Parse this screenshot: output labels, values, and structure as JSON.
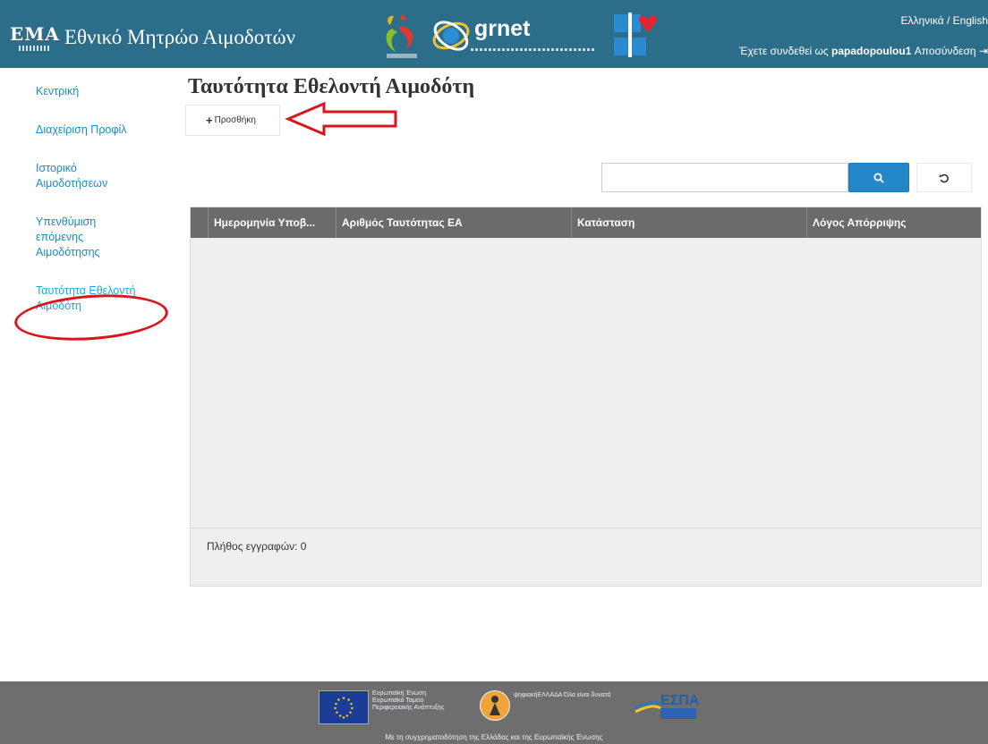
{
  "header": {
    "logo_text": "ΕΜΑ",
    "title": "Εθνικό Μητρώο Αιμοδοτών",
    "partner_logo_text": "grnet",
    "language": "Ελληνικά / English",
    "login_prefix": "Έχετε συνδεθεί ως",
    "username": "papadopoulou1",
    "logout_label": "Αποσύνδεση"
  },
  "sidebar": {
    "items": [
      {
        "label": "Κεντρική"
      },
      {
        "label": "Διαχείριση Προφίλ"
      },
      {
        "label": "Ιστορικό Αιμοδοτήσεων"
      },
      {
        "label": "Υπενθύμιση επόμενης Αιμοδότησης"
      },
      {
        "label": "Ταυτότητα Εθελοντή Αιμοδότη"
      }
    ]
  },
  "main": {
    "title": "Ταυτότητα Εθελοντή Αιμοδότη",
    "add_label": "Προσθήκη",
    "search": {
      "value": "",
      "placeholder": ""
    },
    "grid": {
      "columns": [
        "",
        "Ημερομηνία Υποβ...",
        "Αριθμός Ταυτότητας ΕΑ",
        "Κατάσταση",
        "Λόγος Απόρριψης"
      ],
      "count_label": "Πλήθος εγγραφών: 0"
    }
  },
  "footer": {
    "eu_text": "Ευρωπαϊκή Ένωση Ευρωπαϊκό Ταμείο Περιφερειακής Ανάπτυξης",
    "digital_text": "ψηφιακήΕΛΛΑΔΑ Όλα είναι δυνατά",
    "espa_text": "ΕΣΠΑ",
    "note": "Με τη συγχρηματοδότηση της Ελλάδας και της Ευρωπαϊκής Ένωσης"
  },
  "colors": {
    "header_bg": "#2c6d8a",
    "link": "#1c8bc2",
    "active_link": "#1fa7d8",
    "grid_header": "#6b6b6b",
    "search_button": "#2487c8",
    "annotation": "#d9151e",
    "footer_bg": "#6e6e6e"
  },
  "icons": {
    "search": "search-icon",
    "reset": "refresh-icon",
    "add": "plus-icon",
    "logout": "logout-icon"
  }
}
